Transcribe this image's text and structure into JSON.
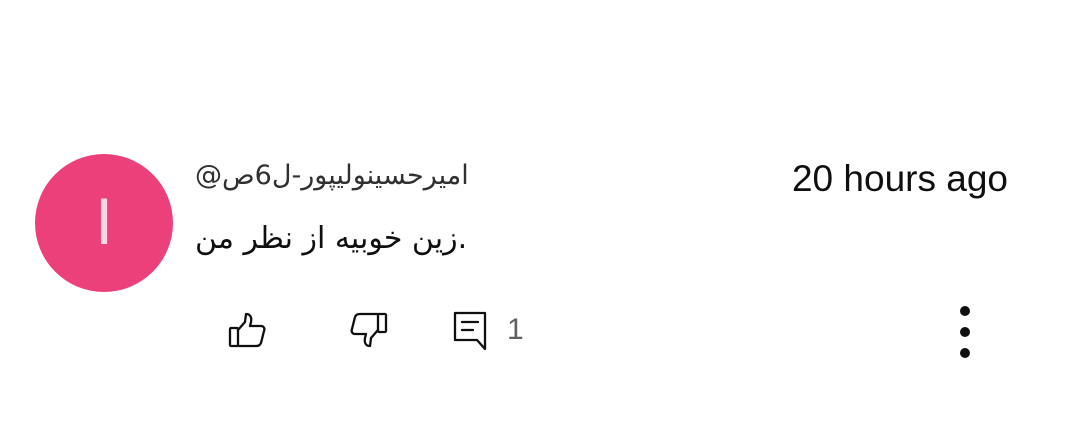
{
  "comment": {
    "avatar_letter": "I",
    "avatar_color": "#ec407a",
    "author": "@امیرحسینولیپور-ل6ص",
    "timestamp": "20 hours ago",
    "text": "زین خوبیه از نظر من.",
    "reply_count": "1",
    "icons": {
      "like": "thumb-up-icon",
      "dislike": "thumb-down-icon",
      "reply": "comment-icon",
      "more": "more-vertical-icon"
    }
  }
}
